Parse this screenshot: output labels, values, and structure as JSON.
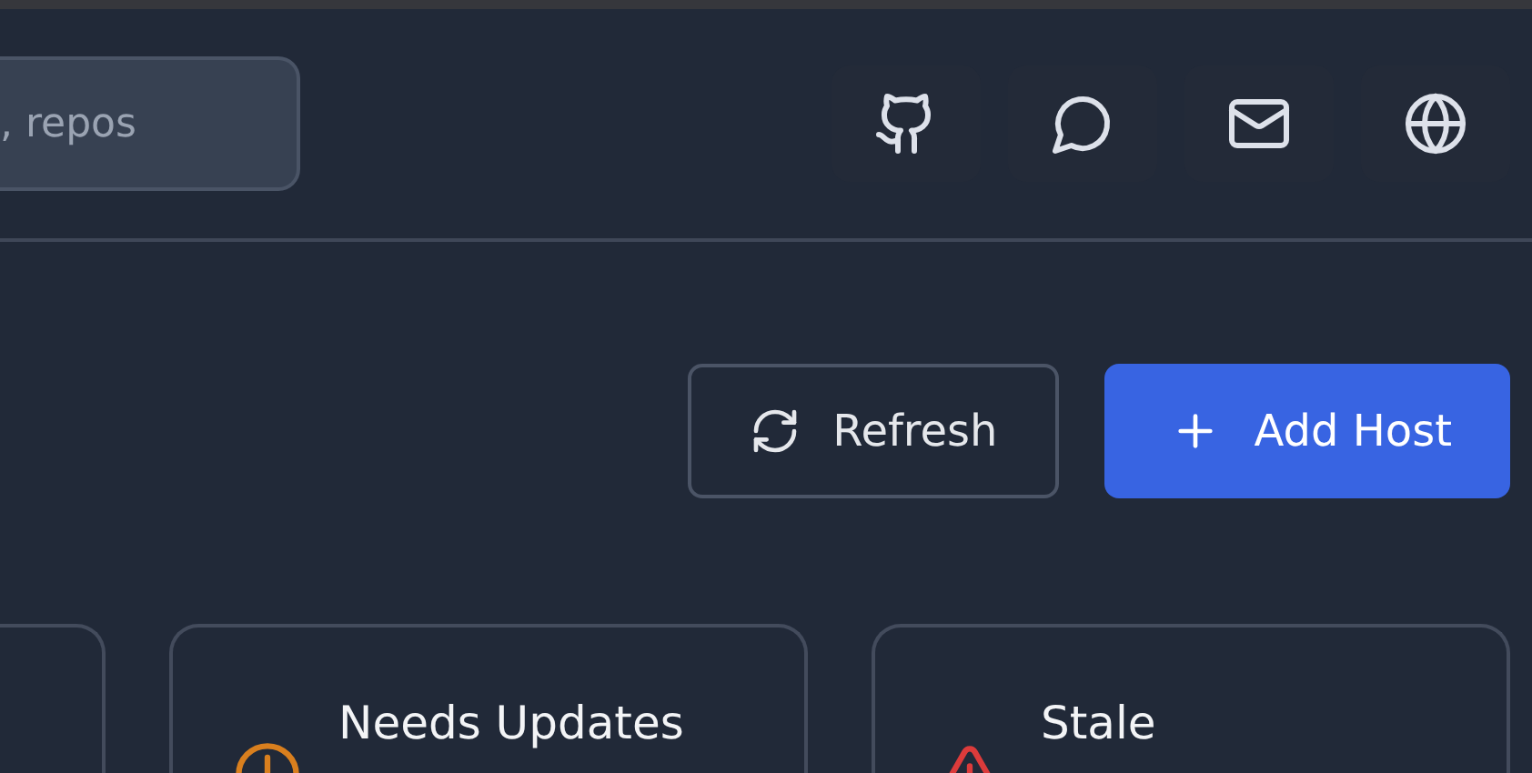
{
  "search": {
    "placeholder": ", repos"
  },
  "header_icons": [
    {
      "kind": "github"
    },
    {
      "kind": "chat"
    },
    {
      "kind": "mail"
    },
    {
      "kind": "globe"
    }
  ],
  "actions": [
    {
      "label": "Refresh",
      "kind": "refresh"
    },
    {
      "label": "Add Host",
      "kind": "add"
    }
  ],
  "cards": [
    {
      "title": "Needs Updates",
      "kind": "clock",
      "color": "#d97f1e"
    },
    {
      "title": "Stale",
      "kind": "warning",
      "color": "#dc3b3b"
    }
  ]
}
